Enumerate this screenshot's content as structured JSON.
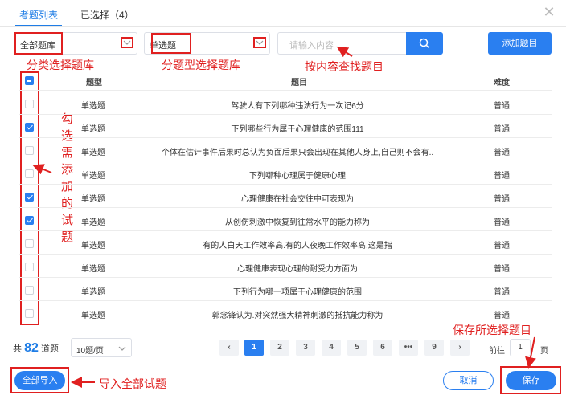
{
  "tabs": {
    "active": "考题列表",
    "selected": "已选择（4）"
  },
  "filters": {
    "bank_select": "全部题库",
    "type_select": "单选题",
    "search_placeholder": "请输入内容",
    "add_button": "添加题目"
  },
  "annotations": {
    "bank": "分类选择题库",
    "type": "分题型选择题库",
    "search": "按内容查找题目",
    "check": "勾选需添加的试题",
    "import": "导入全部试题",
    "save": "保存所选择题目"
  },
  "table": {
    "headers": {
      "type": "题型",
      "question": "题目",
      "difficulty": "难度"
    },
    "rows": [
      {
        "checked": false,
        "type": "单选题",
        "question": "驾驶人有下列哪种违法行为一次记6分",
        "difficulty": "普通"
      },
      {
        "checked": true,
        "type": "单选题",
        "question": "下列哪些行为属于心理健康的范围111",
        "difficulty": "普通"
      },
      {
        "checked": false,
        "type": "单选题",
        "question": "个体在估计事件后果时总认为负面后果只会出现在其他人身上,自己则不会有..",
        "difficulty": "普通"
      },
      {
        "checked": false,
        "type": "单选题",
        "question": "下列哪种心理属于健康心理",
        "difficulty": "普通"
      },
      {
        "checked": true,
        "type": "单选题",
        "question": "心理健康在社会交往中可表现为",
        "difficulty": "普通"
      },
      {
        "checked": true,
        "type": "单选题",
        "question": "从创伤刺激中恢复到往常水平的能力称为",
        "difficulty": "普通"
      },
      {
        "checked": false,
        "type": "单选题",
        "question": "有的人白天工作效率高.有的人夜晚工作效率高.这是指",
        "difficulty": "普通"
      },
      {
        "checked": false,
        "type": "单选题",
        "question": "心理健康表现心理的耐受力方面为",
        "difficulty": "普通"
      },
      {
        "checked": false,
        "type": "单选题",
        "question": "下列行为哪一项属于心理健康的范围",
        "difficulty": "普通"
      },
      {
        "checked": false,
        "type": "单选题",
        "question": "郭念锋认为.对突然强大精神刺激的抵抗能力称为",
        "difficulty": "普通"
      }
    ]
  },
  "pagination": {
    "total_prefix": "共",
    "total": "82",
    "total_suffix": "道题",
    "page_size": "10题/页",
    "pages": [
      "1",
      "2",
      "3",
      "4",
      "5",
      "6",
      "•••",
      "9"
    ],
    "current_page": "1",
    "goto_prefix": "前往",
    "goto_value": "1",
    "goto_suffix": "页"
  },
  "footer": {
    "import_all": "全部导入",
    "cancel": "取消",
    "save": "保存"
  },
  "colors": {
    "accent": "#2a7ff0",
    "annotation": "#e02020"
  }
}
